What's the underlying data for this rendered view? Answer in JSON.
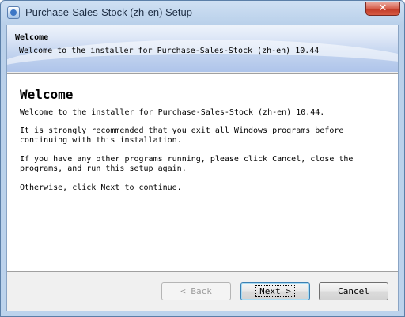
{
  "window": {
    "title": "Purchase-Sales-Stock (zh-en) Setup",
    "close_glyph": "✕"
  },
  "header": {
    "title": "Welcome",
    "subtitle": "Welcome to the installer for Purchase-Sales-Stock (zh-en) 10.44"
  },
  "body": {
    "title": "Welcome",
    "p1": "Welcome to the installer for Purchase-Sales-Stock (zh-en) 10.44.",
    "p2": "It is strongly recommended that you exit all Windows programs before\ncontinuing with this installation.",
    "p3": "If you have any other programs running, please click Cancel, close the\nprograms, and run this setup again.",
    "p4": "Otherwise, click Next to continue."
  },
  "buttons": {
    "back": "< Back",
    "next": "Next >",
    "cancel": "Cancel"
  },
  "icons": {
    "app": "installer-icon",
    "close": "close-icon"
  }
}
